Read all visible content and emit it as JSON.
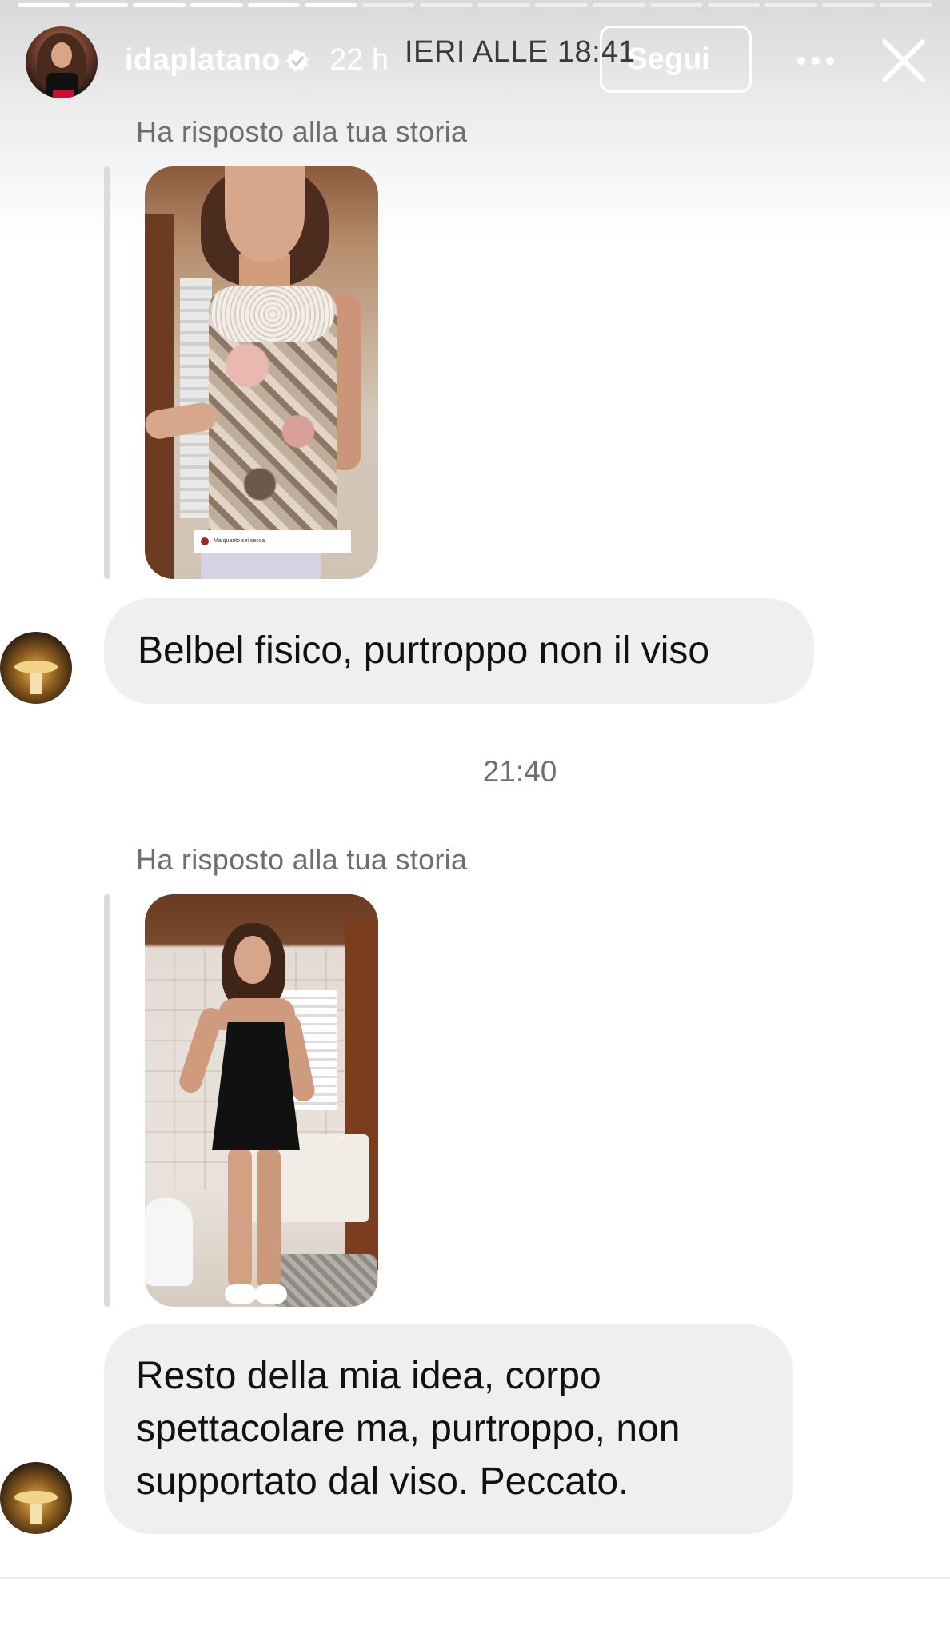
{
  "header": {
    "username": "idaplatano",
    "time_ago": "22 h",
    "date_label": "IERI ALLE 18:41",
    "follow_label": "Segui",
    "verified": true,
    "icons": {
      "verified": "verified-badge-icon",
      "more": "more-dots-icon",
      "close": "close-icon"
    }
  },
  "story_progress": {
    "segments_total": 16,
    "segments_viewed": 6
  },
  "conversation": {
    "messages": [
      {
        "replied_label": "Ha risposto alla tua storia",
        "story_thumbnail_caption": "Ma quanto sei secca",
        "text": "Belbel fisico, purtroppo non il viso"
      },
      {
        "replied_label": "Ha risposto alla tua storia",
        "text": "Resto della mia idea, corpo spettacolare ma, purtroppo, non supportato dal viso. Peccato."
      }
    ],
    "separator_time": "21:40"
  },
  "colors": {
    "bubble_bg": "#efefef",
    "secondary_text": "#6e6e6e",
    "primary_text": "#111111",
    "header_text": "#ffffff"
  }
}
